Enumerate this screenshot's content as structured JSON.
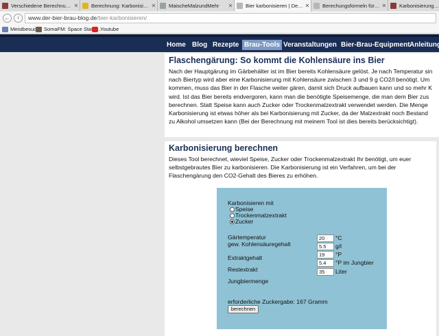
{
  "browser": {
    "tabs": [
      {
        "label": "Verschiedene Berechnung...",
        "icon_color": "#8b3a3a"
      },
      {
        "label": "Berechnung: Karbonisieru...",
        "icon_color": "#e0b428"
      },
      {
        "label": "MaischeMalzundMehr",
        "icon_color": "#9aa39a"
      },
      {
        "label": "Bier karbonisieren | Der Bier-Br...",
        "icon_color": "#b7b7b7"
      },
      {
        "label": "Berechungsformeln für Hausb...",
        "icon_color": "#b7b7b7"
      },
      {
        "label": "Karbonisierung berec",
        "icon_color": "#8b3a3a"
      }
    ],
    "back_icon": "back-arrow-icon",
    "info_icon": "info-icon",
    "url_host": "www.der-bier-brau-blog.de",
    "url_path": "/bier-karbonisieren/",
    "bookmarks": [
      {
        "label": "Meistbesucht",
        "icon_color": "#6b7fb0"
      },
      {
        "label": "SomaFM: Space Statio...",
        "icon_color": "#6b5d50"
      },
      {
        "label": "Youtube",
        "icon_color": "#e02020"
      }
    ]
  },
  "site": {
    "nav": [
      "Home",
      "Blog",
      "Rezepte",
      "Brau-Tools",
      "Veranstaltungen",
      "Bier-Brau-Equipment",
      "Anleitung"
    ],
    "active_nav": "Brau-Tools",
    "section1": {
      "title": "Flaschengärung: So kommt die Kohlensäure ins Bier",
      "lines": [
        "Nach der Hauptgärung im Gärbehälter ist im Bier bereits Kohlensäure gelöst. Je nach Temperatur sin",
        "nach Biertyp wird aber eine Karbonisierung mit Kohlensäure zwischen 3 und 9 g CO2/l benötigt. Um",
        "kommen, muss das Bier in der Flasche weiter gären, damit sich Druck aufbauen kann und so mehr K",
        "wird. Ist das Bier bereits endvergoren, kann man die benötigte Speisemenge, die man dem Bier zus",
        "berechnen. Statt Speise kann auch Zucker oder Trockenmalzextrakt verwendet werden. Die Menge",
        "Karbonisierung ist etwas höher als bei Karbonisierung mit Zucker, da der Malzextrakt noch Bestand",
        "zu Alkohol umsetzen kann (Bei der Berechnung mit meinem Tool ist dies bereits berücksichtigt)."
      ]
    },
    "section2": {
      "title": "Karbonisierung berechnen",
      "lines": [
        "Dieses Tool berechnet, wieviel Speise, Zucker oder Trockenmalzextrakt Ihr benötigt, um euer",
        "selbstgebrautes Bier zu karbonisieren. Die Karbonisierung ist ein Verfahren, um bei der",
        "Flaschengärung den CO2-Gehalt des Bieres zu erhöhen."
      ]
    },
    "tool": {
      "method_label": "Karbonisieren mit",
      "options": [
        "Speise",
        "Trockenmalzextrakt",
        "Zucker"
      ],
      "selected": "Zucker",
      "labels": {
        "temp": "Gärtemperatur",
        "co2": "gew. Kohlensäuregehalt",
        "extract": "Extraktgehalt",
        "rest": "Restextrakt",
        "volume": "Jungbiermenge"
      },
      "fields": [
        {
          "value": "20",
          "unit": "°C"
        },
        {
          "value": "5.5",
          "unit": "g/l"
        },
        {
          "value": "19",
          "unit": "°P"
        },
        {
          "value": "5.4",
          "unit": "°P im Jungbier"
        },
        {
          "value": "35",
          "unit": "Liter"
        }
      ],
      "result": "erforderliche Zuckergabe: 167 Gramm",
      "button": "berechnen"
    }
  }
}
